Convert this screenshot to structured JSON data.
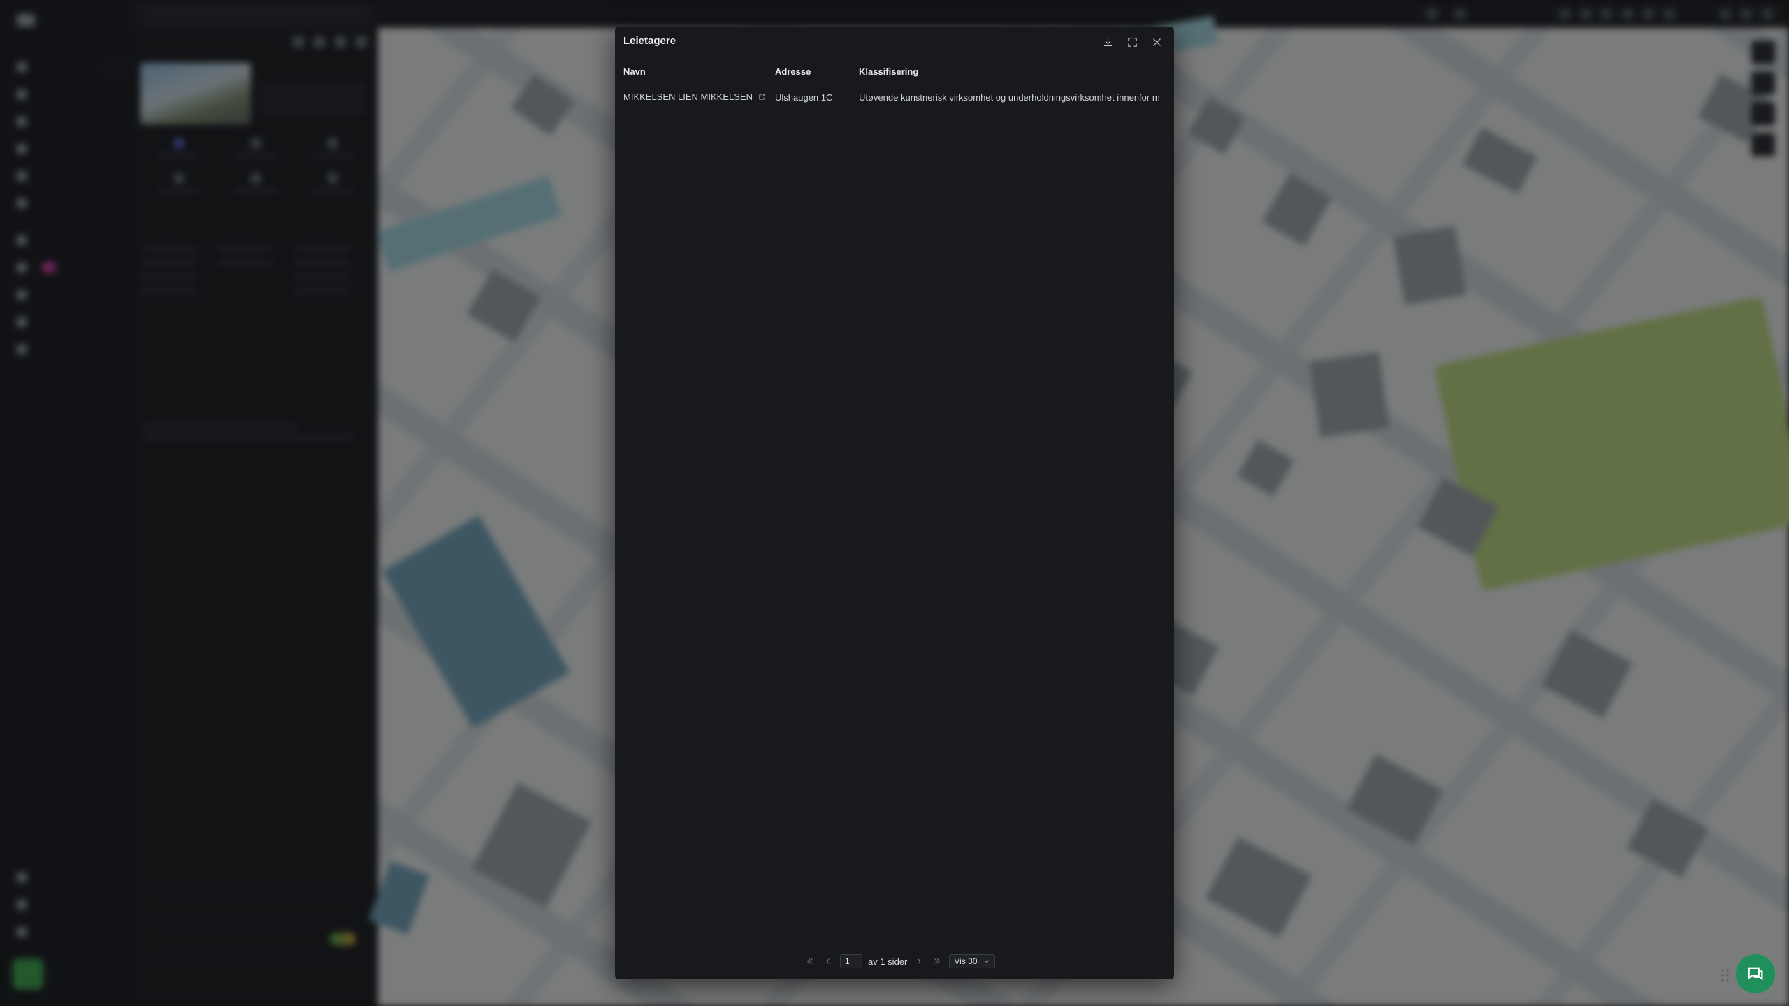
{
  "modal": {
    "title": "Leietagere",
    "columns": [
      "Navn",
      "Adresse",
      "Klassifisering"
    ],
    "rows": [
      {
        "name": "MIKKELSEN LIEN MIKKELSEN",
        "address": "Ulshaugen 1C",
        "classification": "Utøvende kunstnerisk virksomhet og underholdningsvirksomhet innenfor m"
      }
    ],
    "icons": {
      "download": "download-icon",
      "fullscreen": "expand-icon",
      "close": "close-icon",
      "external": "external-link-icon"
    }
  },
  "pagination": {
    "current_page": "1",
    "of_pages_label": "av 1 sider",
    "per_page_label": "Vis 30"
  },
  "colors": {
    "modal_background": "#18191c",
    "chat_button": "#1f8f5c",
    "accent": "#7c83e8"
  }
}
